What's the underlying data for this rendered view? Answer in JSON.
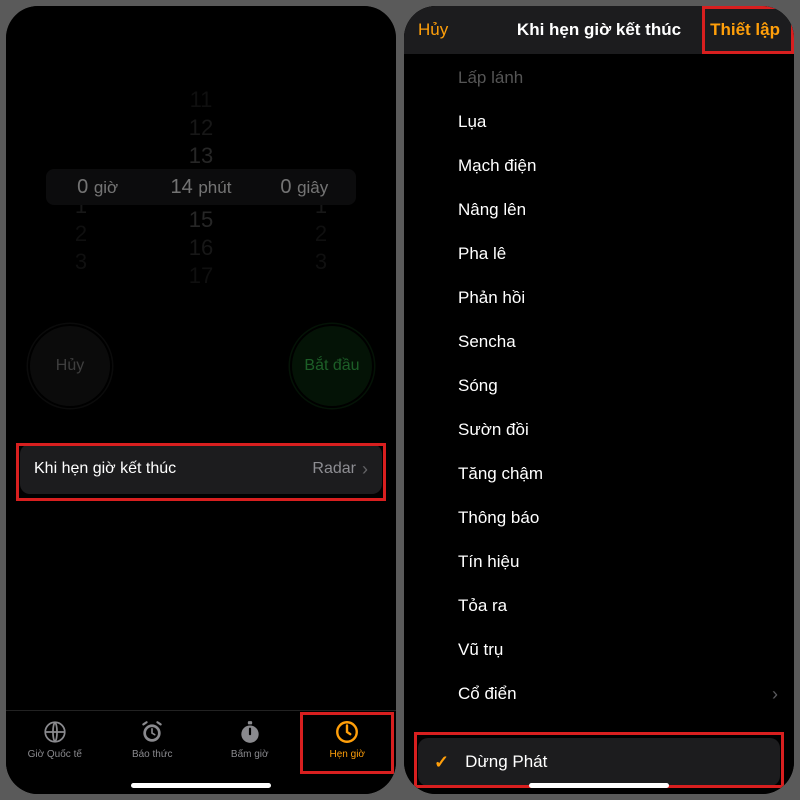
{
  "left": {
    "picker": {
      "hours_before": [
        "",
        ""
      ],
      "hours_sel_num": "0",
      "hours_label": "giờ",
      "hours_after": [
        "1",
        "2",
        "3"
      ],
      "mins_before": [
        "11",
        "12",
        "13"
      ],
      "mins_sel_num": "14",
      "mins_label": "phút",
      "mins_after": [
        "15",
        "16",
        "17"
      ],
      "secs_before": [
        "",
        ""
      ],
      "secs_sel_num": "0",
      "secs_label": "giây",
      "secs_after": [
        "1",
        "2",
        "3"
      ]
    },
    "cancel_btn": "Hủy",
    "start_btn": "Bắt đầu",
    "when_ends_label": "Khi hẹn giờ kết thúc",
    "when_ends_value": "Radar",
    "tabs": {
      "world": "Giờ Quốc tế",
      "alarm": "Báo thức",
      "stopwatch": "Bấm giờ",
      "timer": "Hẹn giờ"
    }
  },
  "right": {
    "header_cancel": "Hủy",
    "header_title": "Khi hẹn giờ kết thúc",
    "header_done": "Thiết lập",
    "sounds": [
      "Lấp lánh",
      "Lụa",
      "Mạch điện",
      "Nâng lên",
      "Pha lê",
      "Phản hồi",
      "Sencha",
      "Sóng",
      "Sườn đồi",
      "Tăng chậm",
      "Thông báo",
      "Tín hiệu",
      "Tỏa ra",
      "Vũ trụ"
    ],
    "classic": "Cổ điển",
    "stop_playing": "Dừng Phát"
  }
}
